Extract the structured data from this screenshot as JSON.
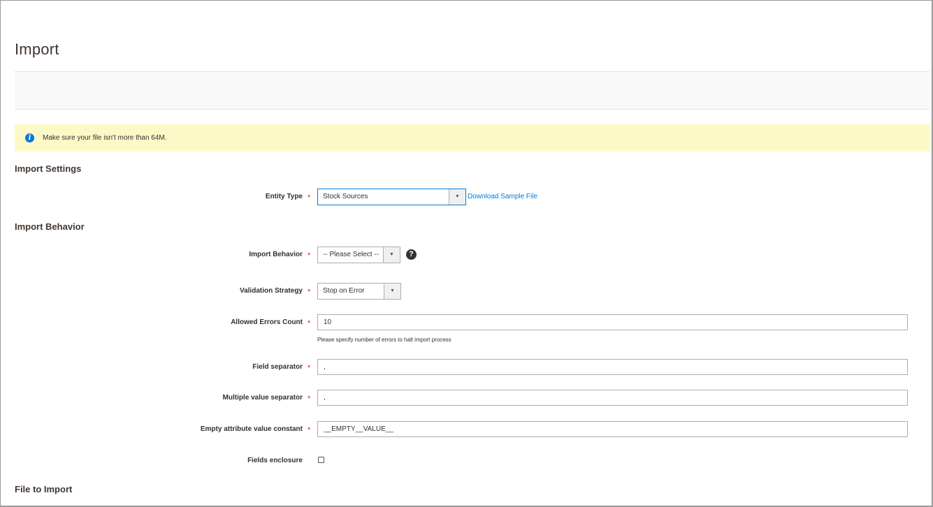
{
  "page": {
    "title": "Import"
  },
  "notice": {
    "text": "Make sure your file isn't more than 64M."
  },
  "sections": {
    "import_settings": "Import Settings",
    "import_behavior": "Import Behavior",
    "file_to_import": "File to Import"
  },
  "fields": {
    "entity_type": {
      "label": "Entity Type",
      "value": "Stock Sources",
      "link": "Download Sample File"
    },
    "import_behavior": {
      "label": "Import Behavior",
      "value": "-- Please Select --"
    },
    "validation_strategy": {
      "label": "Validation Strategy",
      "value": "Stop on Error"
    },
    "allowed_errors": {
      "label": "Allowed Errors Count",
      "value": "10",
      "note": "Please specify number of errors to halt import process"
    },
    "field_separator": {
      "label": "Field separator",
      "value": ","
    },
    "multiple_value_separator": {
      "label": "Multiple value separator",
      "value": ","
    },
    "empty_attribute": {
      "label": "Empty attribute value constant",
      "value": "__EMPTY__VALUE__"
    },
    "fields_enclosure": {
      "label": "Fields enclosure",
      "checked": false
    }
  },
  "symbols": {
    "required": "*",
    "info": "i",
    "help": "?",
    "dropdown": "▼"
  },
  "icons": {
    "notice": "info-icon",
    "help": "help-icon",
    "select_arrow": "chevron-down-icon"
  },
  "colors": {
    "accent": "#007bdb",
    "required": "#e22626",
    "notice_bg": "#fdf9c6"
  }
}
